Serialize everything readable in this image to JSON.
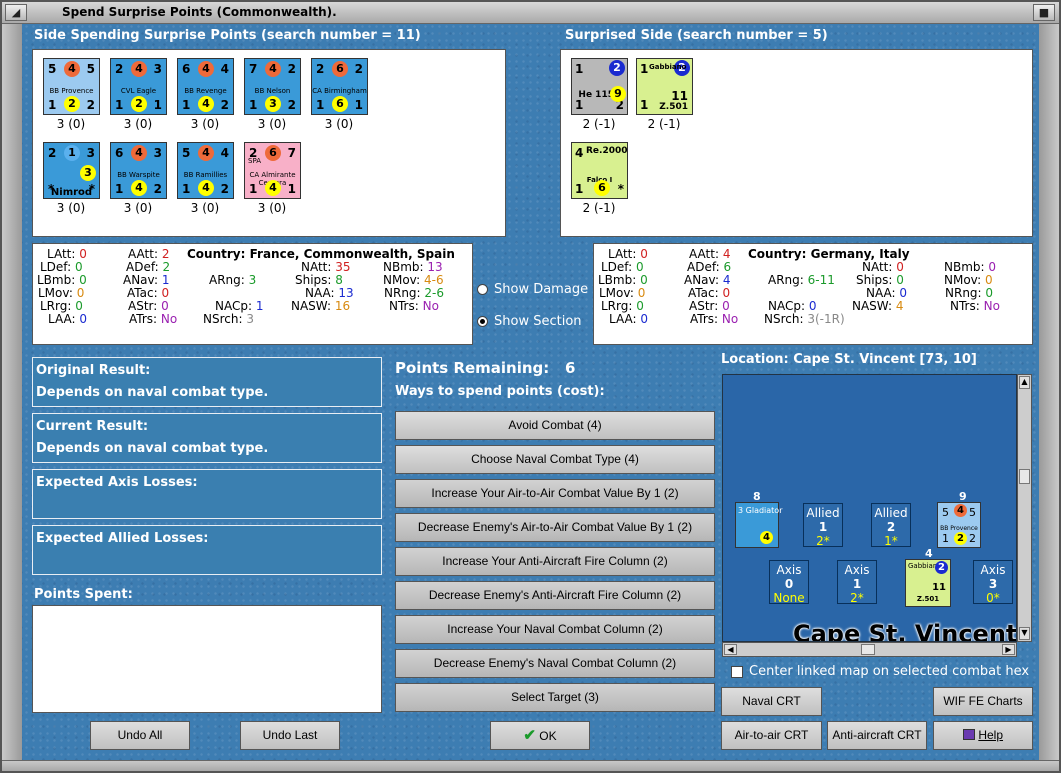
{
  "window": {
    "title": "Spend Surprise Points (Commonwealth).",
    "icon_left": "◢",
    "icon_right": "■"
  },
  "left_side": {
    "header": "Side Spending Surprise Points (search number = 11)",
    "units": [
      {
        "tl": "5",
        "mid": "4",
        "tr": "5",
        "name": "BB Provence",
        "bl": "1",
        "bc": "2",
        "br": "2",
        "val": "3 (0)"
      },
      {
        "tl": "2",
        "mid": "4",
        "tr": "3",
        "name": "CVL Eagle",
        "bl": "1",
        "bc": "2",
        "br": "1",
        "val": "3 (0)"
      },
      {
        "tl": "6",
        "mid": "4",
        "tr": "4",
        "name": "BB Revenge",
        "bl": "1",
        "bc": "4",
        "br": "2",
        "val": "3 (0)"
      },
      {
        "tl": "7",
        "mid": "4",
        "tr": "2",
        "name": "BB Nelson",
        "bl": "1",
        "bc": "3",
        "br": "2",
        "val": "3 (0)"
      },
      {
        "tl": "2",
        "mid": "6",
        "tr": "2",
        "name": "CA Birmingham",
        "bl": "1",
        "bc": "6",
        "br": "1",
        "val": "3 (0)"
      },
      {
        "tl": "2",
        "mid": "1",
        "tr": "3",
        "name": "Nimrod",
        "bl": "*",
        "bc": "",
        "br": "*",
        "val": "3 (0)"
      },
      {
        "tl": "6",
        "mid": "4",
        "tr": "3",
        "name": "BB Warspite",
        "bl": "1",
        "bc": "4",
        "br": "2",
        "val": "3 (0)"
      },
      {
        "tl": "5",
        "mid": "4",
        "tr": "4",
        "name": "BB Ramillies",
        "bl": "1",
        "bc": "4",
        "br": "2",
        "val": "3 (0)"
      },
      {
        "tl": "2",
        "mid": "6",
        "tr": "7",
        "name": "CA Almirante Cervera",
        "nat": "SPA",
        "bl": "1",
        "bc": "4",
        "br": "1",
        "val": "3 (0)"
      }
    ]
  },
  "right_side": {
    "header": "Surprised Side (search number = 5)",
    "units": [
      {
        "tl": "1",
        "mid": "2",
        "name": "He 115C",
        "bc": "9",
        "bl": "1",
        "br": "2",
        "val": "2 (-1)"
      },
      {
        "tl": "1",
        "mid": "2",
        "top": "Gabbiano",
        "name": "Z.501",
        "bc": "11",
        "bl": "1",
        "br": "1",
        "val": "2 (-1)"
      },
      {
        "tl": "4",
        "top": "Re.2000",
        "name": "Falco I",
        "bc": "6",
        "bl": "1",
        "br": "*",
        "val": "2 (-1)"
      }
    ]
  },
  "left_stats": {
    "LAtt": "0",
    "LDef": "0",
    "LBmb": "0",
    "LMov": "0",
    "LRrg": "0",
    "LAA": "0",
    "AAtt": "2",
    "ADef": "2",
    "ANav": "1",
    "ATac": "0",
    "AStr": "0",
    "ATrs": "No",
    "country": "France, Commonwealth, Spain",
    "ARng": "3",
    "NACp": "1",
    "NSrch": "3",
    "NAtt": "35",
    "Ships": "8",
    "NAA": "13",
    "NASW": "16",
    "NBmb": "13",
    "NMov": "4-6",
    "NRng": "2-6",
    "NTrs": "No"
  },
  "right_stats": {
    "LAtt": "0",
    "LDef": "0",
    "LBmb": "0",
    "LMov": "0",
    "LRrg": "0",
    "LAA": "0",
    "AAtt": "4",
    "ADef": "6",
    "ANav": "4",
    "ATac": "0",
    "AStr": "0",
    "ATrs": "No",
    "country": "Germany, Italy",
    "ARng": "6-11",
    "NACp": "0",
    "NSrch": "3(-1R)",
    "NAtt": "0",
    "Ships": "0",
    "NAA": "0",
    "NASW": "4",
    "NBmb": "0",
    "NMov": "0",
    "NRng": "0",
    "NTrs": "No"
  },
  "labels": {
    "latt": "LAtt:",
    "ldef": "LDef:",
    "lbmb": "LBmb:",
    "lmov": "LMov:",
    "lrrg": "LRrg:",
    "laa": "LAA:",
    "aatt": "AAtt:",
    "adef": "ADef:",
    "anav": "ANav:",
    "atac": "ATac:",
    "astr": "AStr:",
    "atrs": "ATrs:",
    "country": "Country:",
    "arng": "ARng:",
    "nacp": "NACp:",
    "nsrch": "NSrch:",
    "natt": "NAtt:",
    "ships": "Ships:",
    "naa": "NAA:",
    "nasw": "NASW:",
    "nbmb": "NBmb:",
    "nmov": "NMov:",
    "nrng": "NRng:",
    "ntrs": "NTrs:"
  },
  "options": {
    "show_damage": "Show Damage",
    "show_section": "Show Section"
  },
  "results": {
    "original_label": "Original Result:",
    "original_value": "Depends on naval combat type.",
    "current_label": "Current Result:",
    "current_value": "Depends on naval combat type.",
    "axis_losses": "Expected Axis Losses:",
    "allied_losses": "Expected Allied Losses:",
    "points_spent": "Points Spent:"
  },
  "points": {
    "remaining_label": "Points Remaining:",
    "remaining": "6",
    "ways": "Ways to spend points (cost):"
  },
  "actions": [
    "Avoid Combat (4)",
    "Choose Naval Combat Type (4)",
    "Increase Your Air-to-Air Combat Value By 1 (2)",
    "Decrease Enemy's Air-to-Air Combat Value By 1 (2)",
    "Increase Your Anti-Aircraft Fire Column (2)",
    "Decrease Enemy's Anti-Aircraft Fire Column (2)",
    "Increase Your Naval Combat Column (2)",
    "Decrease Enemy's Naval Combat Column (2)",
    "Select Target (3)"
  ],
  "map": {
    "location": "Location: Cape St. Vincent [73, 10]",
    "place_name": "Cape St. Vincent",
    "boxes": [
      {
        "side": "Allied",
        "num": "1",
        "sub": "2*"
      },
      {
        "side": "Allied",
        "num": "2",
        "sub": "1*"
      },
      {
        "side": "Axis",
        "num": "0",
        "sub": "None"
      },
      {
        "side": "Axis",
        "num": "1",
        "sub": "2*"
      },
      {
        "side": "Axis",
        "num": "3",
        "sub": "0*"
      }
    ],
    "stacks": {
      "gladiator_count": "8",
      "gladiator_name": "Gladiator",
      "gladiator_val": "3",
      "gladiator_bot": "4",
      "provence_count": "9",
      "provence_name": "BB Provence",
      "gabbiano_count": "4",
      "gabbiano_name": "Gabbiano",
      "gabbiano_bot": "Z.501"
    }
  },
  "center_map": "Center linked map on selected combat hex",
  "buttons": {
    "undo_all": "Undo All",
    "undo_last": "Undo Last",
    "ok": "OK",
    "naval_crt": "Naval CRT",
    "wif_charts": "WIF FE Charts",
    "air_crt": "Air-to-air CRT",
    "aa_crt": "Anti-aircraft CRT",
    "help": "Help"
  }
}
